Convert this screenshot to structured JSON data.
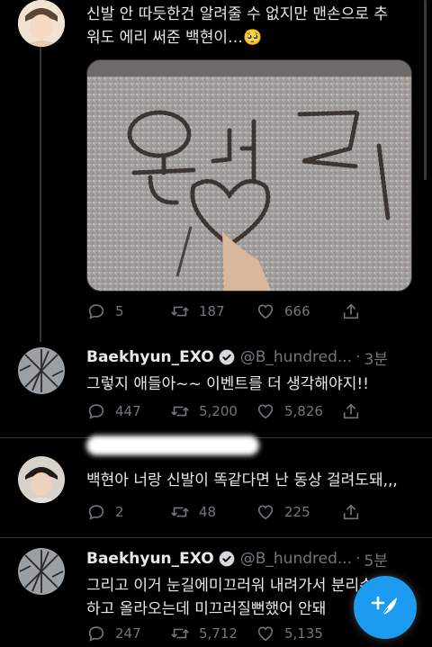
{
  "tweet1": {
    "text_line1": "신발 안 따듯한건 알려줄 수 없지만 맨손으로 추",
    "text_line2": "워도 에리 써준 백현이…🥺",
    "replies": "5",
    "retweets": "187",
    "likes": "666"
  },
  "tweet2": {
    "name": "Baekhyun_EXO",
    "handle": "@B_hundred...",
    "time": "3분",
    "text": "그렇지 애들아~~ 이벤트를 더 생각해야지!!",
    "replies": "447",
    "retweets": "5,200",
    "likes": "5,826"
  },
  "tweet3": {
    "text": "백현아 너랑 신발이 똑같다면 난 동상 걸려도돼,,,",
    "replies": "2",
    "retweets": "48",
    "likes": "225"
  },
  "tweet4": {
    "name": "Baekhyun_EXO",
    "handle": "@B_hundred...",
    "time": "5분",
    "text_line1": "그리고 이거 눈길에미끄러워 내려가서 분리수거",
    "text_line2": "하고 올라오는데 미끄러질뻔했어 안돼",
    "replies": "247",
    "retweets": "5,712",
    "likes": "5,135"
  },
  "colors": {
    "background": "#000000",
    "text": "#e7e9ea",
    "muted": "#71767b",
    "accent": "#1d9bf0"
  },
  "icons": [
    "reply-icon",
    "retweet-icon",
    "like-icon",
    "share-icon",
    "verified-icon",
    "compose-icon"
  ]
}
